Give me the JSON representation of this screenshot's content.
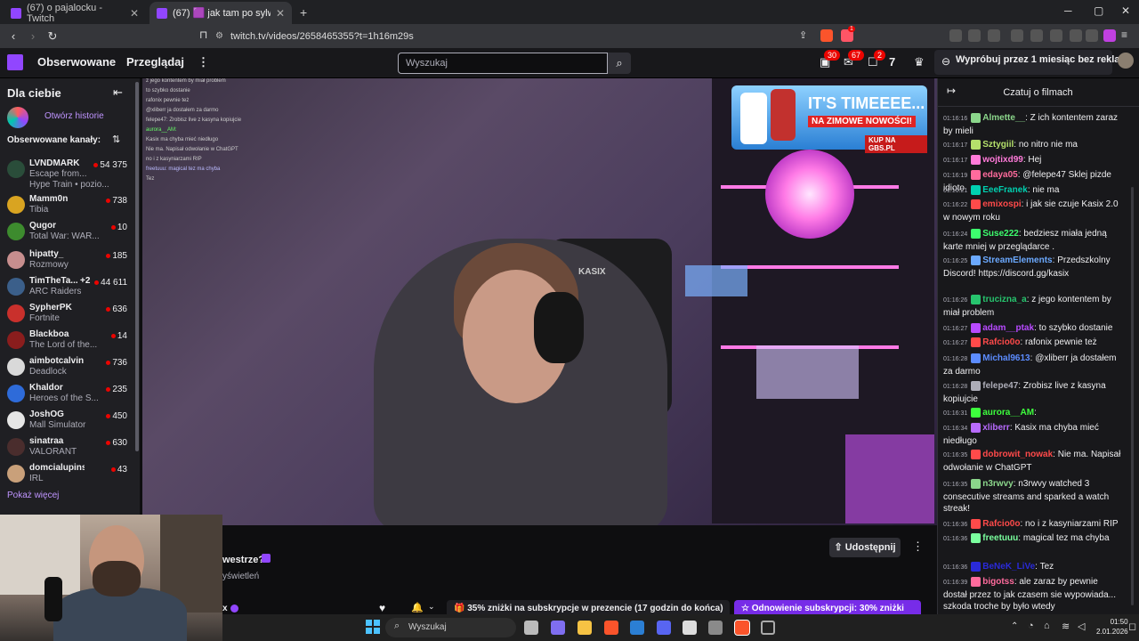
{
  "browser": {
    "tabs": [
      {
        "title": "(67) o pajalocku - Twitch"
      },
      {
        "title": "(67) 🟪 jak tam po sylwestrze",
        "active": true
      }
    ],
    "url": "twitch.tv/videos/2658465355?t=1h16m29s",
    "ext_badges": {
      "notif": "1"
    }
  },
  "topnav": {
    "following": "Obserwowane",
    "browse": "Przeglądaj",
    "search_placeholder": "Wyszukaj",
    "badge_inbox": "30",
    "badge_whispers": "67",
    "badge_notifications": "2",
    "promo": "Wypróbuj przez 1 miesiąc bez reklam"
  },
  "sidebar": {
    "title": "Dla ciebie",
    "stories": "Otwórz historie",
    "followed_header": "Obserwowane kanały:",
    "channels": [
      {
        "name": "LVNDMARK",
        "game": "Escape from...",
        "viewers": "54 375",
        "extra": "Hype Train • pozio...",
        "color": "#2a4d3a"
      },
      {
        "name": "Mamm0n",
        "game": "Tibia",
        "viewers": "738",
        "color": "#d9a421"
      },
      {
        "name": "Qugor",
        "game": "Total War: WAR...",
        "viewers": "10",
        "color": "#3d8b2e"
      },
      {
        "name": "hipatty_",
        "game": "Rozmowy",
        "viewers": "185",
        "color": "#c78e8e"
      },
      {
        "name": "TimTheTa...",
        "game": "ARC Raiders",
        "viewers": "44 611",
        "extra_tag": "+2",
        "color": "#3b5f8a"
      },
      {
        "name": "SypherPK",
        "game": "Fortnite",
        "viewers": "636",
        "color": "#c9302c"
      },
      {
        "name": "Blackboa",
        "game": "The Lord of the...",
        "viewers": "14",
        "color": "#8a1d1d"
      },
      {
        "name": "aimbotcalvin",
        "game": "Deadlock",
        "viewers": "736",
        "color": "#d9d9d9"
      },
      {
        "name": "Khaldor",
        "game": "Heroes of the S...",
        "viewers": "235",
        "color": "#2e6bd9"
      },
      {
        "name": "JoshOG",
        "game": "Mall Simulator",
        "viewers": "450",
        "color": "#e6e6e6"
      },
      {
        "name": "sinatraa",
        "game": "VALORANT",
        "viewers": "630",
        "color": "#4a2d2d"
      },
      {
        "name": "domcialupinska",
        "game": "IRL",
        "viewers": "43",
        "color": "#c9a07a"
      }
    ],
    "show_more": "Pokaż więcej"
  },
  "video": {
    "overlay_chat": [
      {
        "text": "z jego kontentem by miał problem",
        "color": "#cccccc"
      },
      {
        "text": "to szybko dostanie",
        "color": "#cccccc"
      },
      {
        "text": "rafonix pewnie też",
        "color": "#cccccc"
      },
      {
        "text": "@xliberr ja dostałem za darmo",
        "color": "#cccccc"
      },
      {
        "text": "felepe47: Zrobisz live z kasyna kopiujcie",
        "color": "#cccccc"
      },
      {
        "text": "aurora__AM:",
        "color": "#66ff66"
      },
      {
        "text": "Kasix ma chyba mieć niedługo",
        "color": "#cccccc"
      },
      {
        "text": "Nie ma. Napisał odwołanie w ChatGPT",
        "color": "#cccccc"
      },
      {
        "text": "no i z kasyniarzami RIP",
        "color": "#cccccc"
      },
      {
        "text": "freetuuu: magical tez ma chyba",
        "color": "#bbbbff"
      },
      {
        "text": "Tez",
        "color": "#cccccc"
      }
    ],
    "ad": {
      "headline": "IT'S TIMEEEE...",
      "sub": "NA ZIMOWE NOWOŚCI!",
      "cta": "KUP NA GBS.PL"
    },
    "chair_logo": "KASIX"
  },
  "below_video": {
    "title_fragment": "westrze?",
    "views_fragment": "yświetleń",
    "name_fragment": "x",
    "share": "Udostępnij",
    "sub_offer": "35% zniżki na subskrypcje w prezencie (17 godzin do końca)",
    "renew": "Odnowienie subskrypcji: 30% zniżki"
  },
  "chat": {
    "header": "Czatuj o filmach",
    "messages": [
      {
        "ts": "01:16:16",
        "user": "Almette__",
        "color": "#8bd68b",
        "text": "Z ich kontentem zaraz by mieli"
      },
      {
        "ts": "01:16:17",
        "user": "Sztygiil",
        "color": "#b5e06b",
        "text": "no nitro nie ma"
      },
      {
        "ts": "01:16:17",
        "user": "wojtixd99",
        "color": "#ff7ad9",
        "text": "Hej"
      },
      {
        "ts": "01:16:19",
        "user": "edaya05",
        "color": "#ff6b9d",
        "text": "@felepe47 Sklej pizde idioto"
      },
      {
        "ts": "01:16:21",
        "user": "EeeFranek",
        "color": "#00d0b0",
        "text": "nie ma"
      },
      {
        "ts": "01:16:22",
        "user": "emixospi",
        "color": "#ff4a4a",
        "text": "i jak sie czuje Kasix 2.0 w nowym roku"
      },
      {
        "ts": "01:16:24",
        "user": "Suse222",
        "color": "#3dff6e",
        "text": "bedziesz miała jedną karte mniej w przeglądarce ."
      },
      {
        "ts": "01:16:25",
        "user": "StreamElements",
        "color": "#6ba9ff",
        "text": "Przedszkolny Discord! https://discord.gg/kasix"
      },
      {
        "ts": "01:16:26",
        "user": "trucizna_a",
        "color": "#27c46e",
        "text": "z jego kontentem by miał problem"
      },
      {
        "ts": "01:16:27",
        "user": "adam__ptak",
        "color": "#b84aff",
        "text": "to szybko dostanie"
      },
      {
        "ts": "01:16:27",
        "user": "Rafcio0o",
        "color": "#ff4a4a",
        "text": "rafonix pewnie też"
      },
      {
        "ts": "01:16:28",
        "user": "Michal9613",
        "color": "#5c8cff",
        "text": "@xliberr ja dostałem za darmo"
      },
      {
        "ts": "01:16:28",
        "user": "felepe47",
        "color": "#adadb8",
        "text": "Zrobisz live z kasyna kopiujcie"
      },
      {
        "ts": "01:16:31",
        "user": "aurora__AM",
        "color": "#3dff3d",
        "text": ""
      },
      {
        "ts": "01:16:34",
        "user": "xliberr",
        "color": "#b86bff",
        "text": "Kasix ma chyba mieć niedługo"
      },
      {
        "ts": "01:16:35",
        "user": "dobrowit_nowak",
        "color": "#ff4a4a",
        "text": "Nie ma. Napisał odwołanie w ChatGPT"
      },
      {
        "ts": "01:16:35",
        "user": "n3rwvy",
        "color": "#8bd68b",
        "text": "n3rwvy watched 3 consecutive streams and sparked a watch streak!"
      },
      {
        "ts": "01:16:36",
        "user": "Rafcio0o",
        "color": "#ff4a4a",
        "text": "no i z kasyniarzami RIP"
      },
      {
        "ts": "01:16:36",
        "user": "freetuuu",
        "color": "#7aff9e",
        "text": "magical tez ma chyba"
      },
      {
        "ts": "01:16:36",
        "user": "BeNeK_LiVe",
        "color": "#2a2ad9",
        "text": "Tez"
      },
      {
        "ts": "01:16:39",
        "user": "bigotss",
        "color": "#ff6b9d",
        "text": "ale zaraz by pewnie dostał przez to jak czasem sie wypowiada... szkoda troche by było wtedy"
      }
    ]
  },
  "taskbar": {
    "search": "Wyszukaj",
    "time": "01:50",
    "date": "2.01.2026"
  }
}
